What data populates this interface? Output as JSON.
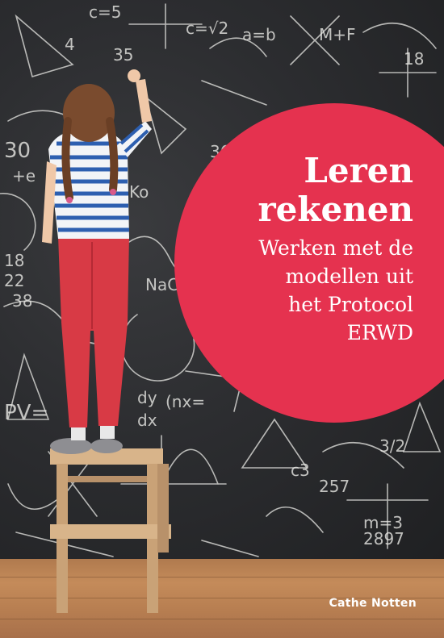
{
  "cover": {
    "title_lines": [
      "Leren",
      "rekenen"
    ],
    "subtitle_lines": [
      "Werken met de",
      "modellen uit",
      "het Protocol",
      "ERWD"
    ],
    "author": "Cathe Notten"
  },
  "colors": {
    "accent_circle": "#e5324f",
    "chalkboard": "#2c2d30",
    "floor": "#b98052",
    "text": "#ffffff"
  },
  "chalk_scribbles": [
    "c=5",
    "4",
    "35",
    "c=√2",
    "a=b",
    "M+F",
    "18",
    "30",
    "+e",
    "PV=",
    "dy",
    "dx",
    "(nx=",
    "257",
    "36",
    "3/2",
    "m=3",
    "2897",
    "c3",
    "Ko",
    "NaCl",
    "18",
    "22",
    "38"
  ]
}
